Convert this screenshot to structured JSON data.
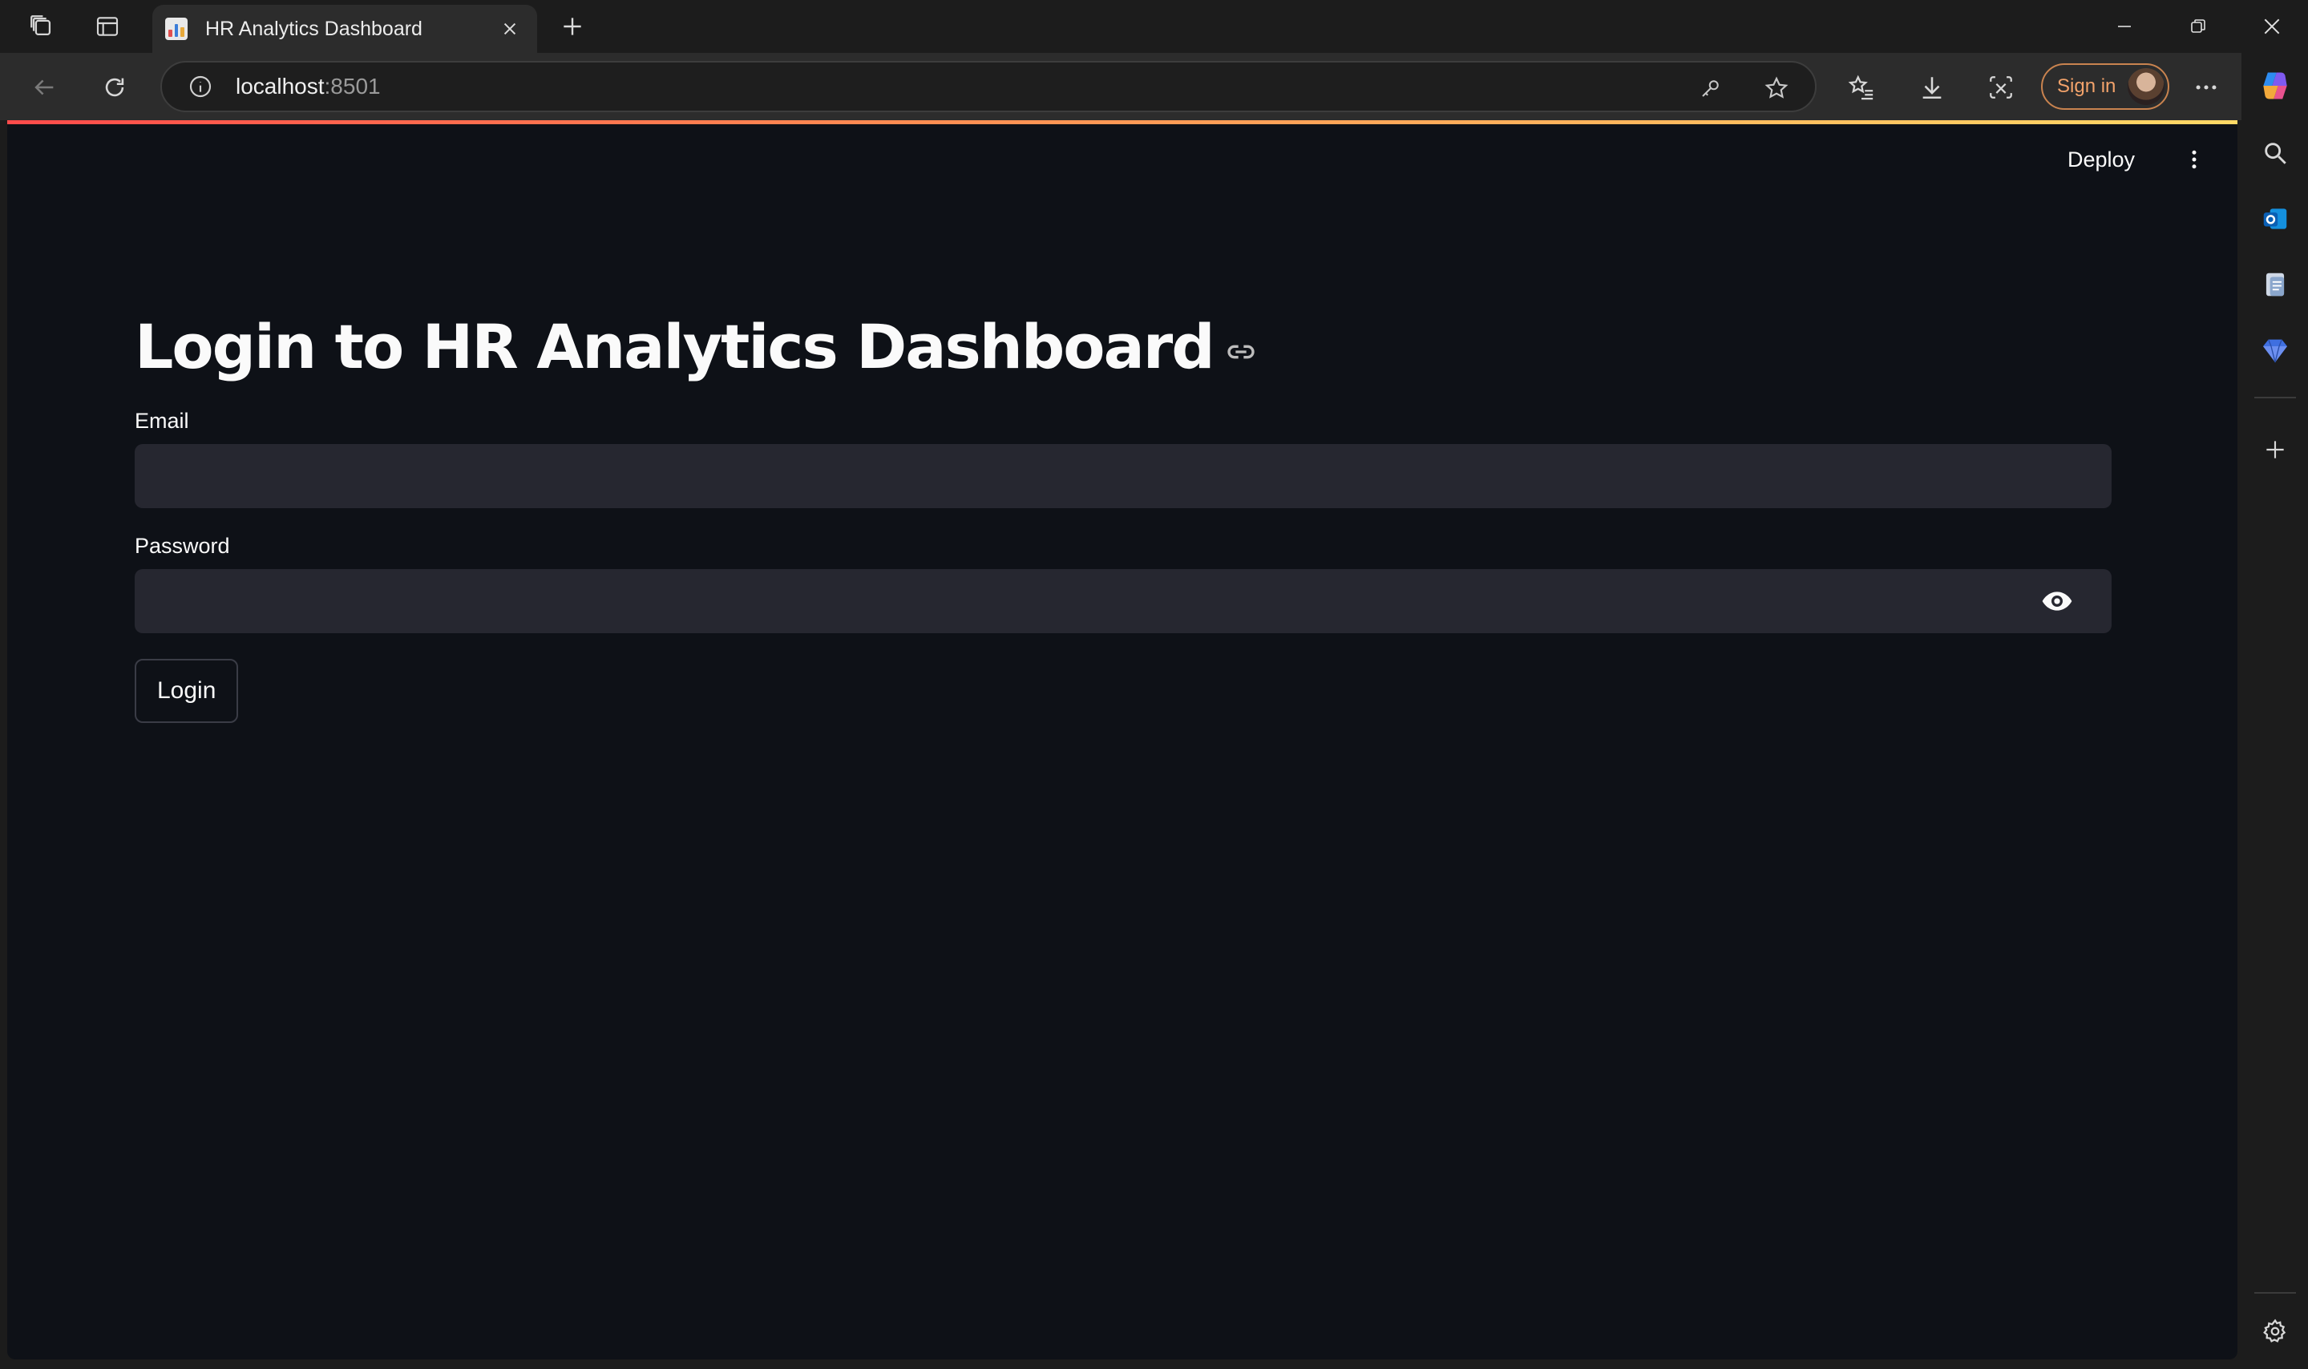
{
  "browser": {
    "tab": {
      "title": "HR Analytics Dashboard",
      "favicon": "bar-chart-icon"
    },
    "address": {
      "host": "localhost",
      "port": ":8501"
    },
    "sign_in_label": "Sign in",
    "accent": "#f3a36b"
  },
  "app": {
    "header": {
      "deploy_label": "Deploy"
    },
    "title": "Login to HR Analytics Dashboard",
    "form": {
      "email_label": "Email",
      "email_value": "",
      "password_label": "Password",
      "password_value": "",
      "login_label": "Login"
    },
    "colors": {
      "background": "#0e1117",
      "input_bg": "#262730",
      "text": "#fafafa"
    }
  }
}
